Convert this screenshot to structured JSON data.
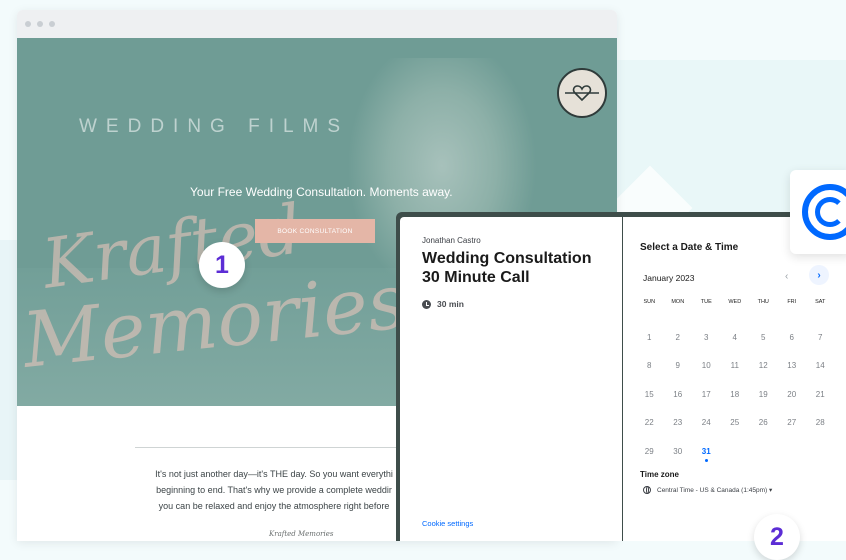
{
  "site": {
    "kicker": "WEDDING FILMS",
    "script_line_1": "Krafted",
    "script_line_2": "Memories",
    "tagline": "Your Free Wedding Consultation. Moments away.",
    "book_button": "BOOK CONSULTATION",
    "body_lines": [
      "It's not just another day—it's THE day. So you want everythi",
      "beginning to end. That's why we provide a complete weddir",
      "you can be relaxed and enjoy the atmosphere right before"
    ],
    "signature": "Krafted Memories"
  },
  "badges": {
    "step1": "1",
    "step2": "2"
  },
  "booking": {
    "host": "Jonathan Castro",
    "title": "Wedding Consultation 30 Minute Call",
    "duration": "30 min",
    "cookie_settings": "Cookie settings",
    "heading": "Select a Date & Time",
    "month": "January 2023",
    "prev": "‹",
    "next": "›",
    "weekdays": [
      "SUN",
      "MON",
      "TUE",
      "WED",
      "THU",
      "FRI",
      "SAT"
    ],
    "days": [
      "1",
      "2",
      "3",
      "4",
      "5",
      "6",
      "7",
      "8",
      "9",
      "10",
      "11",
      "12",
      "13",
      "14",
      "15",
      "16",
      "17",
      "18",
      "19",
      "20",
      "21",
      "22",
      "23",
      "24",
      "25",
      "26",
      "27",
      "28",
      "29",
      "30",
      "31"
    ],
    "selected_day": "31",
    "timezone_label": "Time zone",
    "timezone_value": "Central Time - US & Canada (1:45pm) ▾"
  },
  "colors": {
    "accent": "#0069ff",
    "badge_text": "#5c2dd5",
    "hero": "#6f9c95",
    "button": "#e4b6a7"
  },
  "icons": {
    "brand": "heart-knot-logo-icon",
    "clock": "clock-icon",
    "globe": "globe-icon",
    "app": "calendly-logo-icon"
  }
}
